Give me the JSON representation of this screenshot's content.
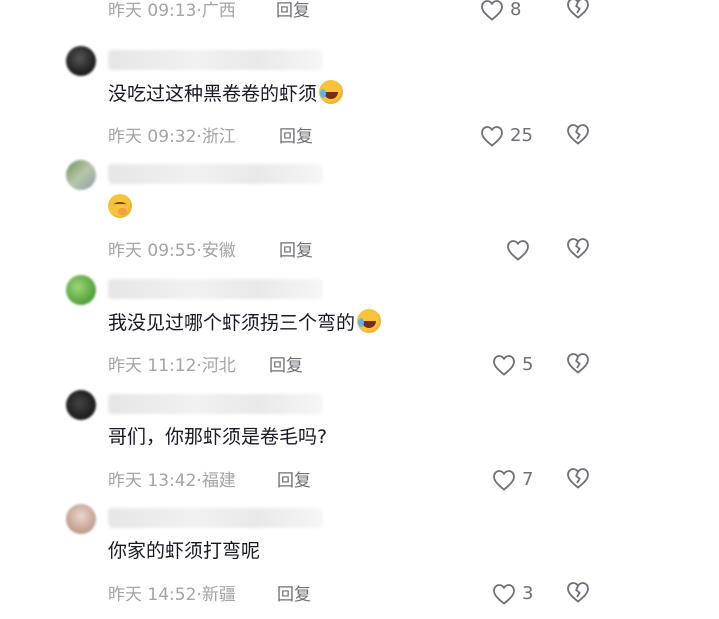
{
  "comments": [
    {
      "username": "",
      "text": "",
      "emoji": "",
      "time": "昨天 09:13",
      "location": "广西",
      "reply": "回复",
      "likes": "8"
    },
    {
      "username": "",
      "text": "没吃过这种黑卷卷的虾须",
      "emoji": "laugh-cry",
      "time": "昨天 09:32",
      "location": "浙江",
      "reply": "回复",
      "likes": "25"
    },
    {
      "username": "",
      "text": "",
      "emoji": "shy",
      "time": "昨天 09:55",
      "location": "安徽",
      "reply": "回复",
      "likes": ""
    },
    {
      "username": "",
      "text": "我没见过哪个虾须拐三个弯的",
      "emoji": "laugh-cry",
      "time": "昨天 11:12",
      "location": "河北",
      "reply": "回复",
      "likes": "5"
    },
    {
      "username": "",
      "text": "哥们，你那虾须是卷毛吗?",
      "emoji": "",
      "time": "昨天 13:42",
      "location": "福建",
      "reply": "回复",
      "likes": "7"
    },
    {
      "username": "",
      "text": "你家的虾须打弯呢",
      "emoji": "",
      "time": "昨天 14:52",
      "location": "新疆",
      "reply": "回复",
      "likes": "3"
    }
  ],
  "icons": {
    "like": "heart-outline-icon",
    "dislike": "broken-heart-icon"
  },
  "colors": {
    "text": "#161823",
    "meta": "#a3a3a8",
    "action": "#6f6f76"
  }
}
